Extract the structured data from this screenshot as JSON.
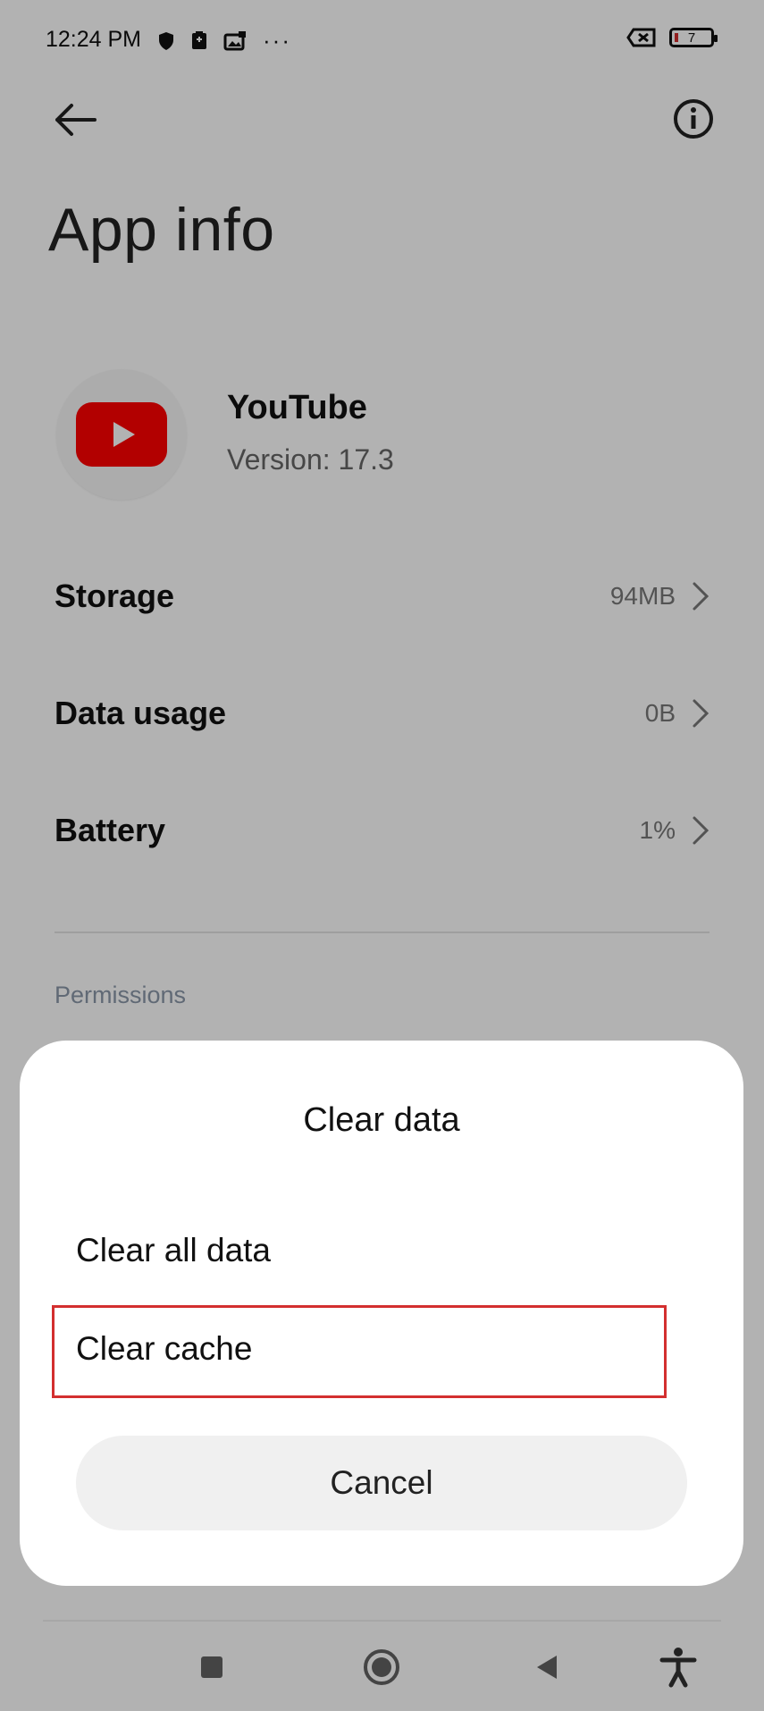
{
  "status_bar": {
    "time": "12:24 PM",
    "more": "···",
    "battery_level": "7",
    "icons_left": [
      "shield-icon",
      "sim-icon",
      "gallery-icon",
      "more-dots-icon"
    ],
    "icons_right": [
      "no-signal-icon",
      "battery-icon"
    ]
  },
  "header": {
    "title": "App info",
    "icons": [
      "back-arrow-icon",
      "info-icon"
    ]
  },
  "app": {
    "name": "YouTube",
    "version": "Version: 17.3",
    "icon": "youtube-logo-icon"
  },
  "rows": [
    {
      "label": "Storage",
      "value": "94MB"
    },
    {
      "label": "Data usage",
      "value": "0B"
    },
    {
      "label": "Battery",
      "value": "1%"
    }
  ],
  "section": {
    "permissions_label": "Permissions"
  },
  "dialog": {
    "title": "Clear data",
    "options": [
      "Clear all data",
      "Clear cache"
    ],
    "cancel_label": "Cancel",
    "highlighted_option": "Clear cache",
    "highlight_color": "#d32f2f"
  },
  "nav_bar": {
    "icons": [
      "recents-square-icon",
      "home-circle-icon",
      "back-triangle-icon",
      "accessibility-icon"
    ]
  },
  "colors": {
    "youtube_red": "#ff0000",
    "scrim": "rgba(0,0,0,0.30)"
  }
}
